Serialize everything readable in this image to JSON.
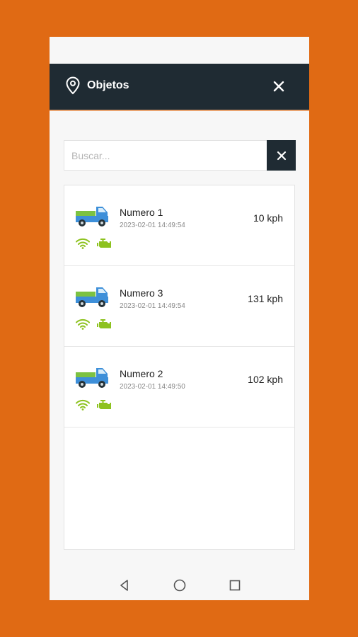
{
  "header": {
    "title": "Objetos"
  },
  "search": {
    "placeholder": "Buscar..."
  },
  "objects": [
    {
      "name": "Numero 1",
      "timestamp": "2023-02-01 14:49:54",
      "speed": "10 kph"
    },
    {
      "name": "Numero 3",
      "timestamp": "2023-02-01 14:49:54",
      "speed": "131 kph"
    },
    {
      "name": "Numero 2",
      "timestamp": "2023-02-01 14:49:50",
      "speed": "102 kph"
    }
  ],
  "icons": {
    "header": [
      "location-pin-icon",
      "close-icon"
    ],
    "search": [
      "close-icon"
    ],
    "row": [
      "truck-icon",
      "wifi-icon",
      "engine-icon"
    ],
    "nav": [
      "back-icon",
      "home-icon",
      "recents-icon"
    ]
  },
  "colors": {
    "background": "#e06a14",
    "header": "#1f2b33",
    "status_green": "#8dc21f",
    "truck_blue": "#3d8fd9",
    "truck_green": "#7cc242"
  }
}
